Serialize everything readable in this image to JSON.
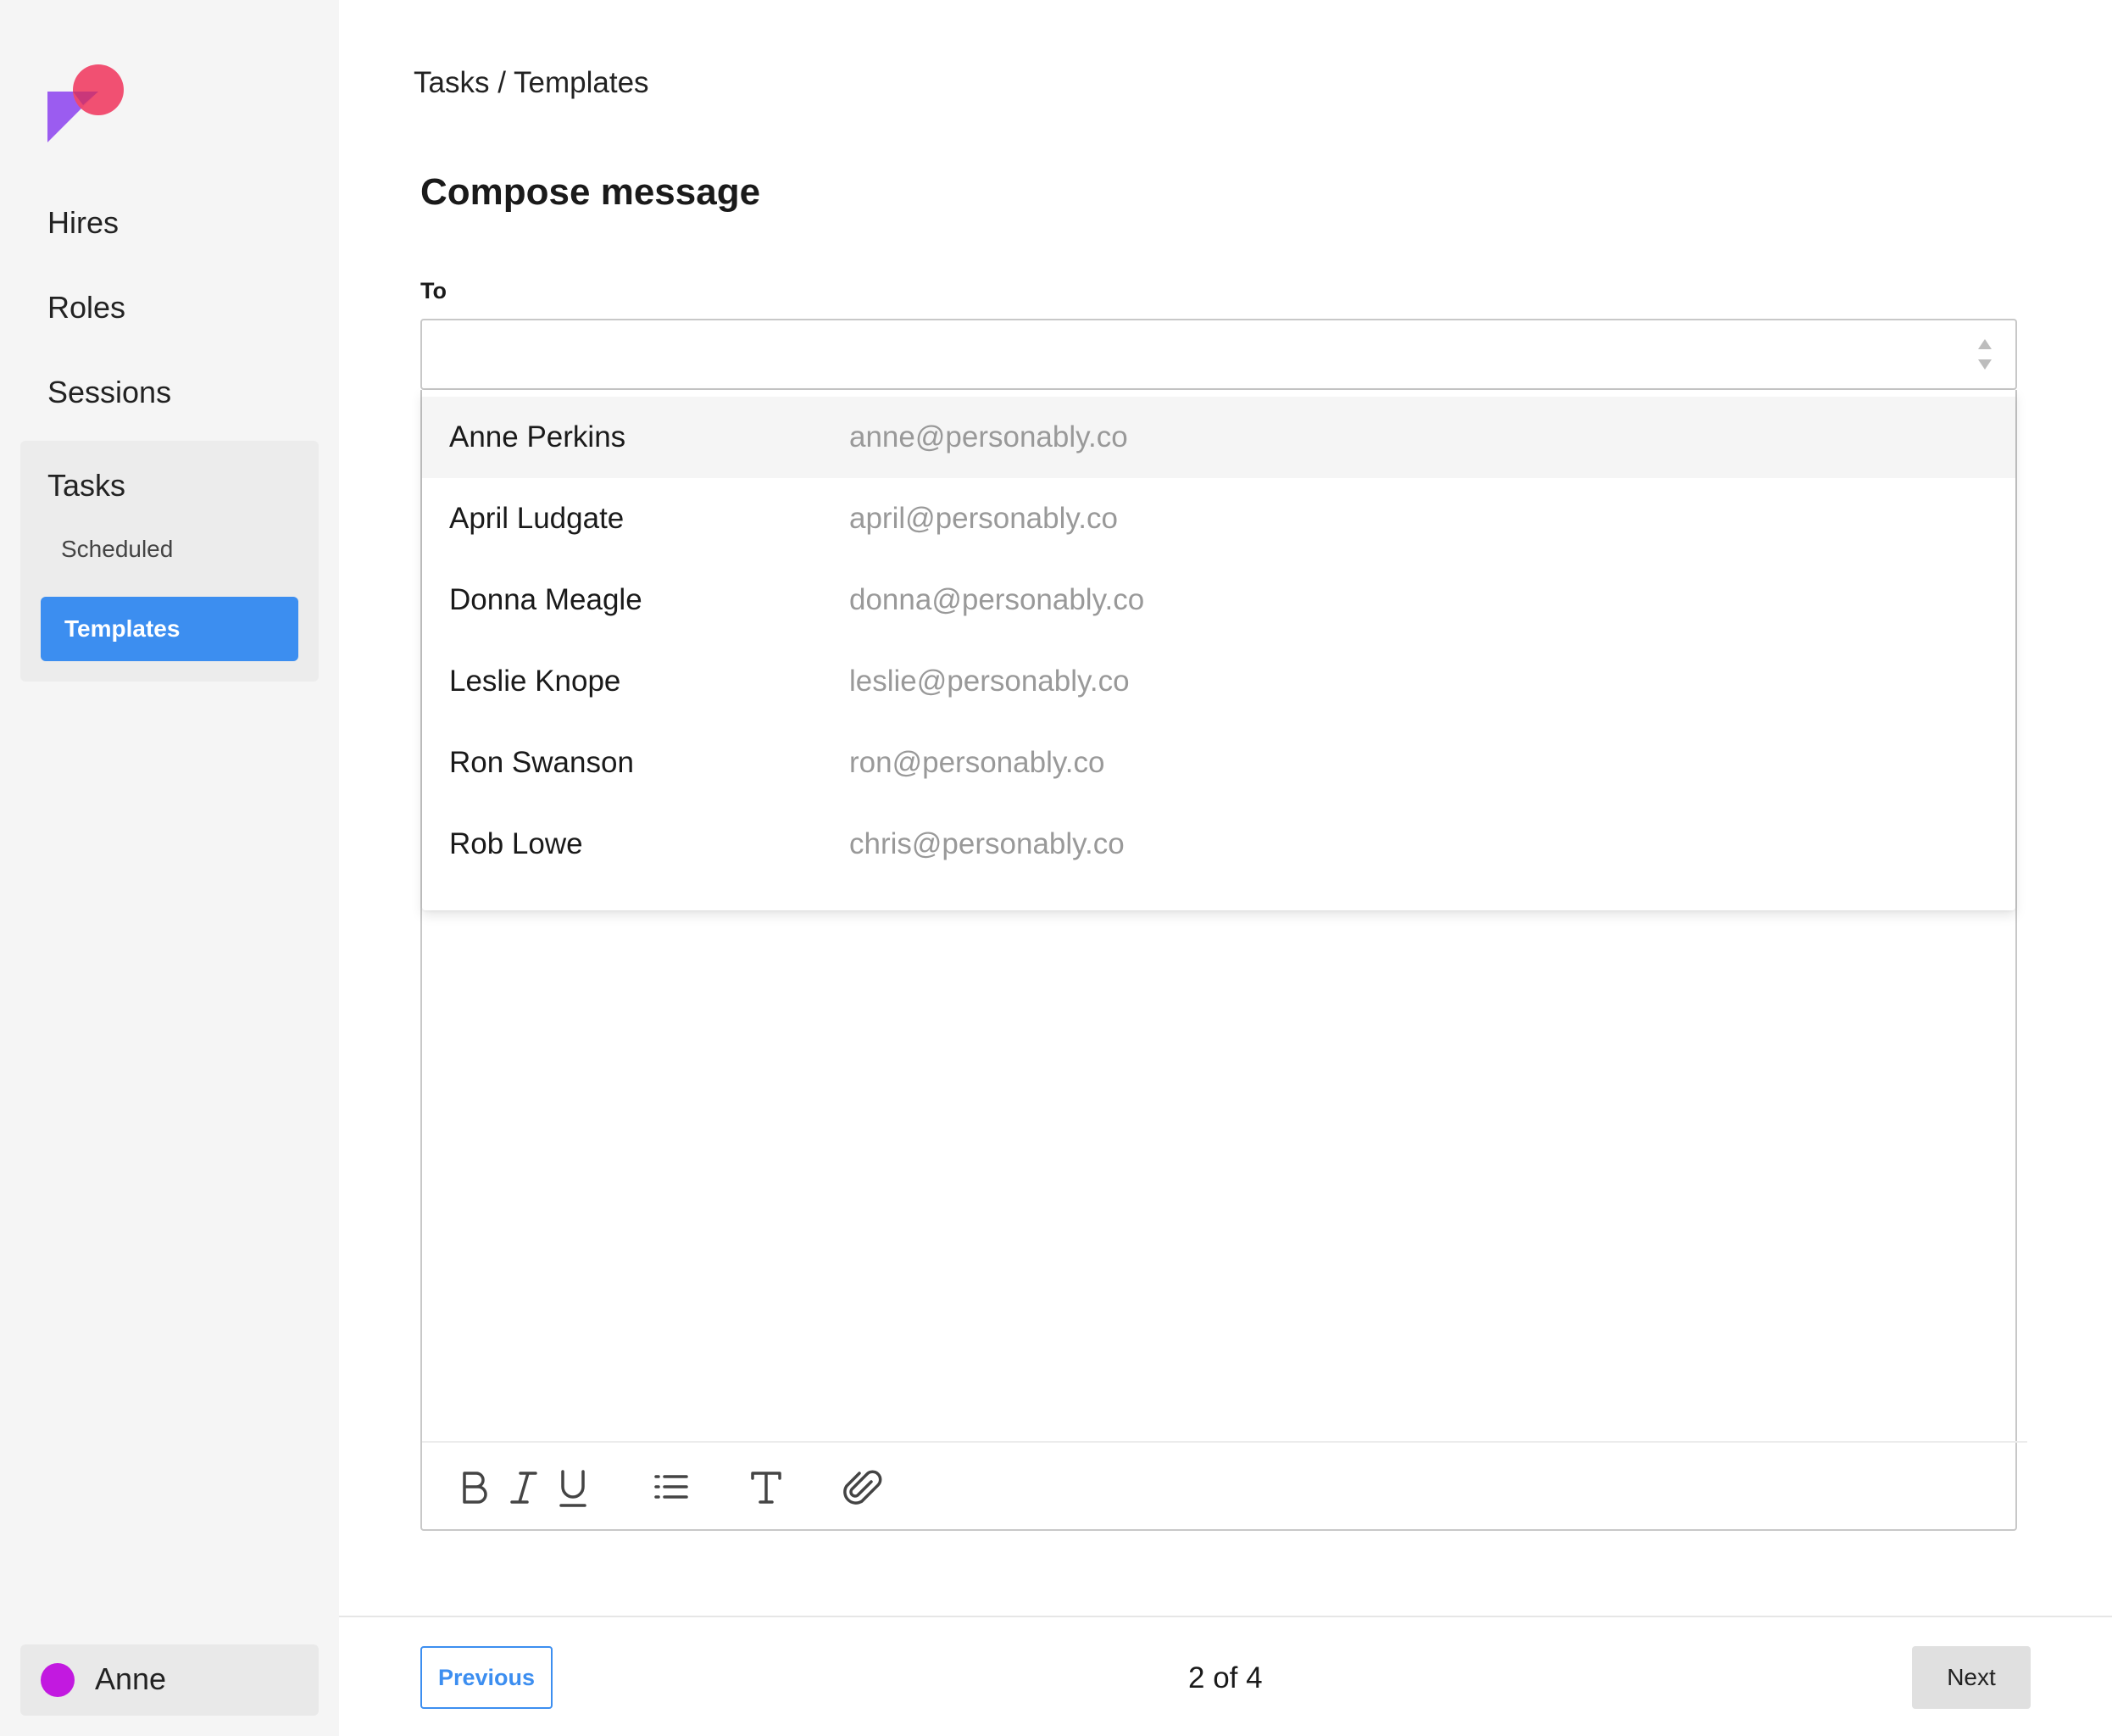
{
  "sidebar": {
    "nav": [
      {
        "label": "Hires"
      },
      {
        "label": "Roles"
      },
      {
        "label": "Sessions"
      }
    ],
    "tasks": {
      "label": "Tasks",
      "sub_items": [
        {
          "label": "Scheduled",
          "active": false
        },
        {
          "label": "Templates",
          "active": true
        }
      ]
    },
    "user": {
      "name": "Anne",
      "avatar_color": "#c219e0"
    }
  },
  "breadcrumb": {
    "parent": "Tasks",
    "separator": "/",
    "current": "Templates"
  },
  "page_title": "Compose message",
  "to_field": {
    "label": "To",
    "value": ""
  },
  "recipients": [
    {
      "name": "Anne Perkins",
      "email": "anne@personably.co",
      "highlighted": true
    },
    {
      "name": "April Ludgate",
      "email": "april@personably.co",
      "highlighted": false
    },
    {
      "name": "Donna Meagle",
      "email": "donna@personably.co",
      "highlighted": false
    },
    {
      "name": "Leslie Knope",
      "email": "leslie@personably.co",
      "highlighted": false
    },
    {
      "name": "Ron Swanson",
      "email": "ron@personably.co",
      "highlighted": false
    },
    {
      "name": "Rob Lowe",
      "email": "chris@personably.co",
      "highlighted": false
    }
  ],
  "toolbar": {
    "icons": [
      "bold-icon",
      "italic-icon",
      "underline-icon",
      "list-icon",
      "text-icon",
      "paperclip-icon"
    ]
  },
  "footer": {
    "previous_label": "Previous",
    "pager": "2 of 4",
    "next_label": "Next"
  },
  "colors": {
    "accent": "#3c8ef0",
    "sidebar_bg": "#f5f5f5",
    "logo_pink": "#f0476a",
    "logo_purple": "#9b5cf0"
  }
}
